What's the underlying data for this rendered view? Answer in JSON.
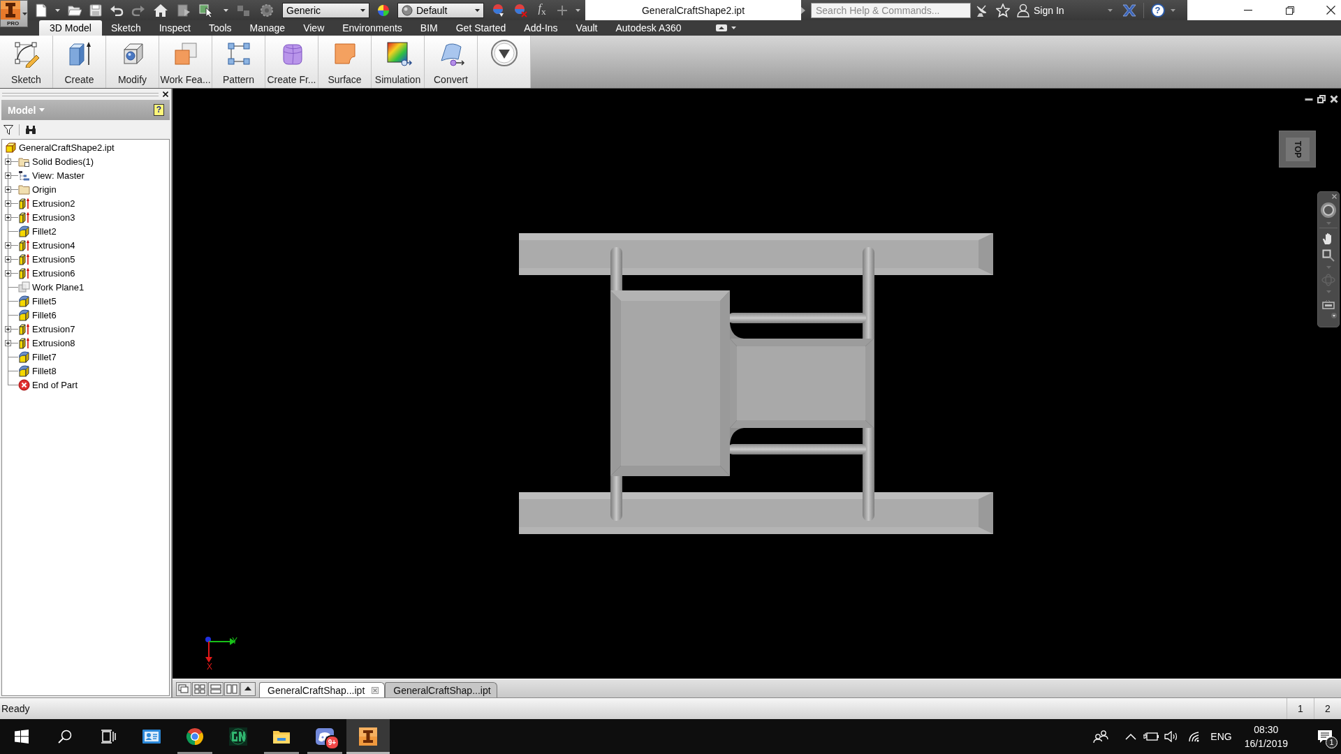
{
  "app_button": {
    "badge": "PRO"
  },
  "quick_access": {
    "style": "Generic",
    "appearance": "Default",
    "formula": "*f*$_{x}$"
  },
  "window": {
    "title": "GeneralCraftShape2.ipt"
  },
  "help_bar": {
    "search_placeholder": "Search Help & Commands...",
    "sign_in": "Sign In",
    "help": "?"
  },
  "ribbon_tabs": [
    {
      "label": "3D Model",
      "selected": true
    },
    {
      "label": "Sketch",
      "selected": false
    },
    {
      "label": "Inspect",
      "selected": false
    },
    {
      "label": "Tools",
      "selected": false
    },
    {
      "label": "Manage",
      "selected": false
    },
    {
      "label": "View",
      "selected": false
    },
    {
      "label": "Environments",
      "selected": false
    },
    {
      "label": "BIM",
      "selected": false
    },
    {
      "label": "Get Started",
      "selected": false
    },
    {
      "label": "Add-Ins",
      "selected": false
    },
    {
      "label": "Vault",
      "selected": false
    },
    {
      "label": "Autodesk A360",
      "selected": false
    }
  ],
  "ribbon_buttons": [
    {
      "label": "Sketch",
      "kind": "sketch"
    },
    {
      "label": "Create",
      "kind": "create"
    },
    {
      "label": "Modify",
      "kind": "modify"
    },
    {
      "label": "Work Fea...",
      "kind": "work-features"
    },
    {
      "label": "Pattern",
      "kind": "pattern"
    },
    {
      "label": "Create Fr...",
      "kind": "freeform"
    },
    {
      "label": "Surface",
      "kind": "surface"
    },
    {
      "label": "Simulation",
      "kind": "simulation"
    },
    {
      "label": "Convert",
      "kind": "convert"
    }
  ],
  "browser": {
    "title": "Model",
    "help": "?",
    "tree": {
      "label": "GeneralCraftShape2.ipt",
      "kind": "part",
      "children": [
        {
          "label": "Solid Bodies(1)",
          "kind": "solid-bodies",
          "expandable": true
        },
        {
          "label": "View: Master",
          "kind": "view",
          "expandable": true
        },
        {
          "label": "Origin",
          "kind": "folder",
          "expandable": true
        },
        {
          "label": "Extrusion2",
          "kind": "extrusion",
          "expandable": true
        },
        {
          "label": "Extrusion3",
          "kind": "extrusion",
          "expandable": true
        },
        {
          "label": "Fillet2",
          "kind": "fillet",
          "expandable": false
        },
        {
          "label": "Extrusion4",
          "kind": "extrusion",
          "expandable": true
        },
        {
          "label": "Extrusion5",
          "kind": "extrusion",
          "expandable": true
        },
        {
          "label": "Extrusion6",
          "kind": "extrusion",
          "expandable": true
        },
        {
          "label": "Work Plane1",
          "kind": "work-plane",
          "expandable": false
        },
        {
          "label": "Fillet5",
          "kind": "fillet",
          "expandable": false
        },
        {
          "label": "Fillet6",
          "kind": "fillet",
          "expandable": false
        },
        {
          "label": "Extrusion7",
          "kind": "extrusion",
          "expandable": true
        },
        {
          "label": "Extrusion8",
          "kind": "extrusion",
          "expandable": true
        },
        {
          "label": "Fillet7",
          "kind": "fillet",
          "expandable": false
        },
        {
          "label": "Fillet8",
          "kind": "fillet",
          "expandable": false
        },
        {
          "label": "End of Part",
          "kind": "end-of-part",
          "expandable": false
        }
      ]
    }
  },
  "viewport": {
    "view_cube": "TOP",
    "axes": [
      {
        "kind": "y",
        "label": "Y"
      },
      {
        "kind": "x",
        "label": "X"
      }
    ]
  },
  "document_tabs": [
    {
      "label": "GeneralCraftShap...ipt",
      "selected": true
    },
    {
      "label": "GeneralCraftShap...ipt",
      "selected": false
    }
  ],
  "status_bar": {
    "text": "Ready",
    "cells": [
      "1",
      "2"
    ]
  },
  "taskbar": {
    "apps": [
      {
        "kind": "contacts",
        "running": false,
        "selected": false
      },
      {
        "kind": "browser",
        "running": true,
        "selected": false
      },
      {
        "kind": "game",
        "running": false,
        "selected": false
      },
      {
        "kind": "explorer",
        "running": true,
        "selected": false
      },
      {
        "kind": "chat",
        "running": true,
        "selected": false,
        "badge": "9+"
      },
      {
        "kind": "cad",
        "running": true,
        "selected": true
      }
    ],
    "tray": {
      "language": "ENG",
      "time": "08:30",
      "date": "16/1/2019",
      "notifications": "1"
    }
  }
}
